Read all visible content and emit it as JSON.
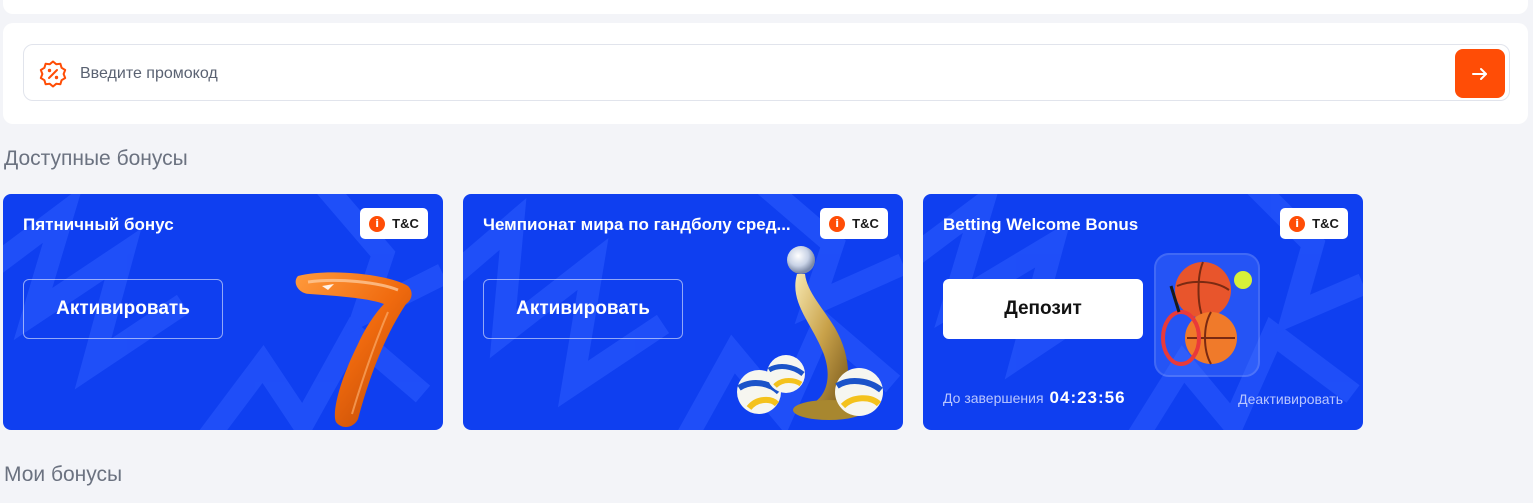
{
  "promo": {
    "placeholder": "Введите промокод",
    "value": "",
    "icon": "discount-badge-icon",
    "submit_icon": "arrow-right-icon",
    "accent_color": "#ff4d06"
  },
  "sections": {
    "available_title": "Доступные бонусы",
    "my_title": "Мои бонусы"
  },
  "cards": [
    {
      "title": "Пятничный бонус",
      "tc_label": "T&C",
      "tc_icon": "info-icon",
      "action_label": "Активировать",
      "art": "boomerang"
    },
    {
      "title": "Чемпионат мира по гандболу сред...",
      "tc_label": "T&C",
      "tc_icon": "info-icon",
      "action_label": "Активировать",
      "art": "trophy-with-volleyballs"
    },
    {
      "title": "Betting Welcome Bonus",
      "tc_label": "T&C",
      "tc_icon": "info-icon",
      "action_label": "Депозит",
      "art": "sports-balls-bag",
      "timer_label": "До завершения",
      "timer_value": "04:23:56",
      "deactivate_label": "Деактивировать"
    }
  ],
  "colors": {
    "card_background": "#0f3ff0",
    "page_background": "#f3f4f8",
    "accent": "#ff4d06"
  }
}
